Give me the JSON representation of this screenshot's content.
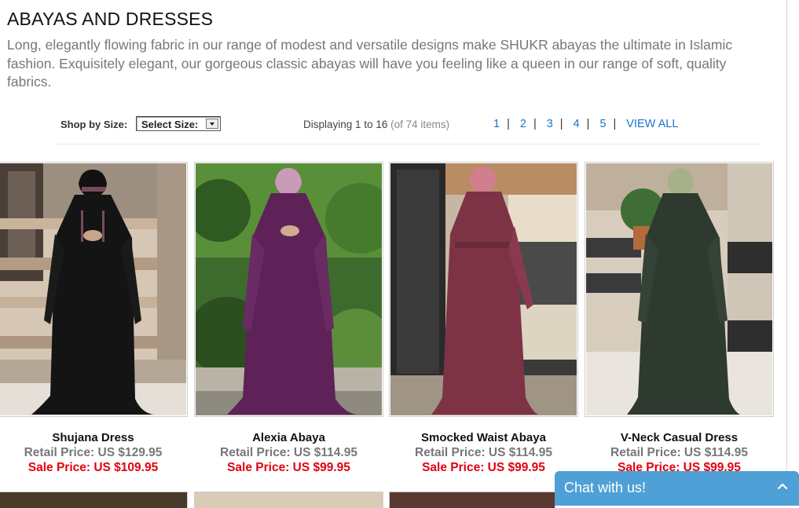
{
  "page": {
    "title": "ABAYAS AND DRESSES",
    "intro": "Long, elegantly flowing fabric in our range of modest and versatile designs make SHUKR abayas the ultimate in Islamic fashion. Exquisitely elegant, our gorgeous classic abayas will have you feeling like a queen in our range of soft, quality fabrics."
  },
  "toolbar": {
    "size_label": "Shop by Size:",
    "size_select_value": "Select Size:",
    "display_prefix": "Displaying",
    "display_from": "1",
    "display_to_word": "to",
    "display_to": "16",
    "display_total": "(of 74 items)",
    "pages": [
      "1",
      "2",
      "3",
      "4",
      "5"
    ],
    "view_all": "VIEW ALL",
    "separator": "|"
  },
  "products": [
    {
      "name": "Shujana Dress",
      "retail": "Retail Price: US $129.95",
      "sale": "Sale Price: US $109.95",
      "dress_color": "#141414"
    },
    {
      "name": "Alexia Abaya",
      "retail": "Retail Price: US $114.95",
      "sale": "Sale Price: US $99.95",
      "dress_color": "#5e2259"
    },
    {
      "name": "Smocked Waist Abaya",
      "retail": "Retail Price: US $114.95",
      "sale": "Sale Price: US $99.95",
      "dress_color": "#7d3345"
    },
    {
      "name": "V-Neck Casual Dress",
      "retail": "Retail Price: US $114.95",
      "sale": "Sale Price: US $99.95",
      "dress_color": "#2e3a30"
    }
  ],
  "chat": {
    "label": "Chat with us!"
  },
  "colors": {
    "link": "#1a74c9",
    "sale": "#e3000f",
    "chat_bg": "#4ea0d6"
  }
}
